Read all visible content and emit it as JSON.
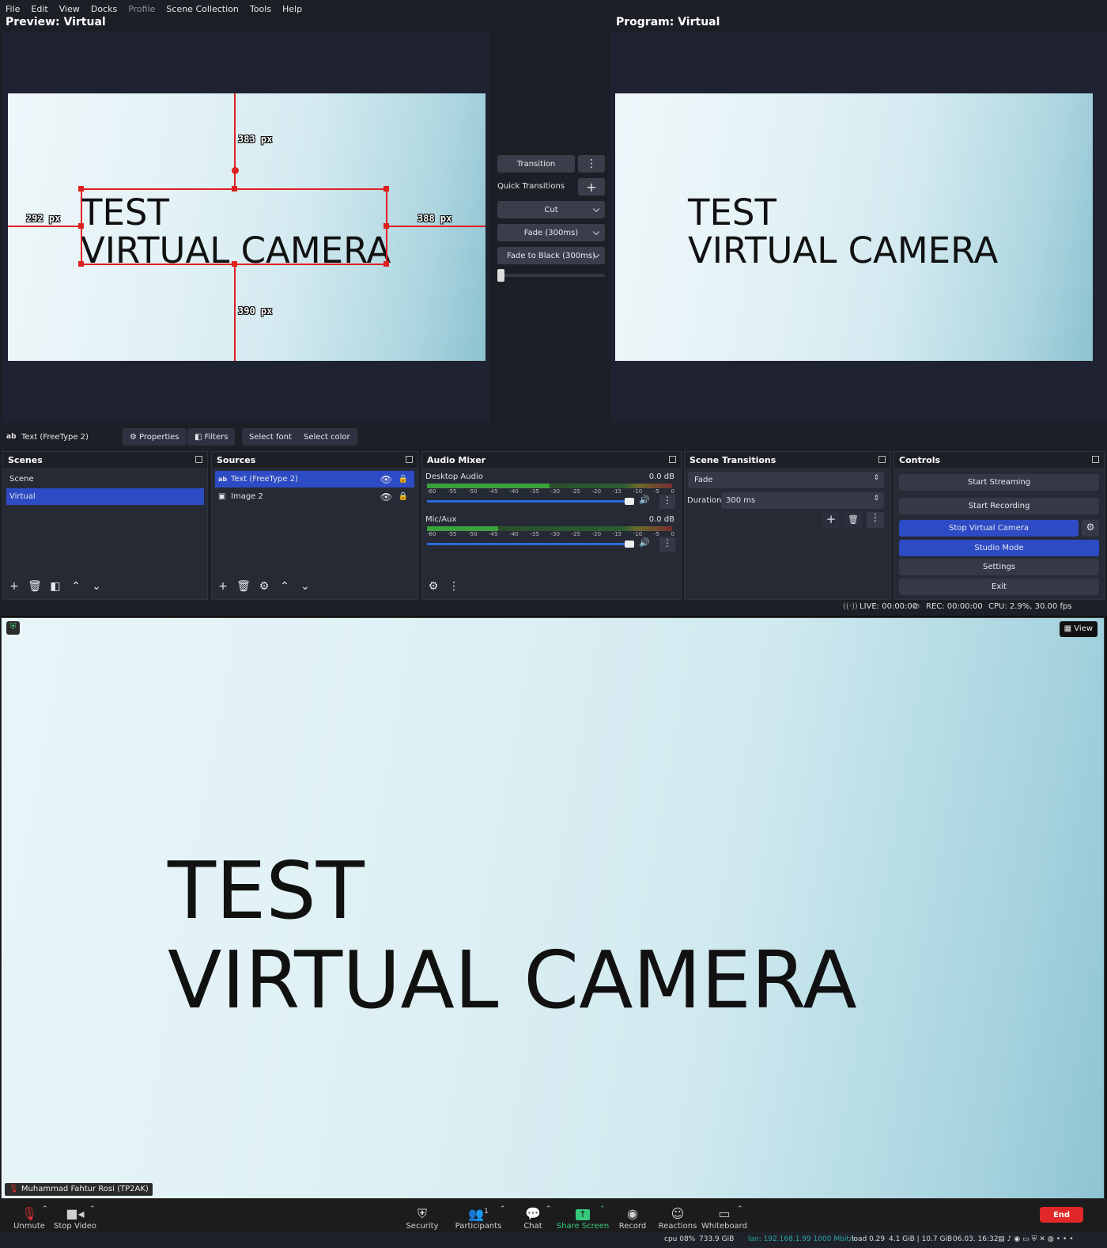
{
  "menu": [
    {
      "label": "File",
      "dim": false
    },
    {
      "label": "Edit",
      "dim": false
    },
    {
      "label": "View",
      "dim": false
    },
    {
      "label": "Docks",
      "dim": false
    },
    {
      "label": "Profile",
      "dim": true
    },
    {
      "label": "Scene Collection",
      "dim": false
    },
    {
      "label": "Tools",
      "dim": false
    },
    {
      "label": "Help",
      "dim": false
    }
  ],
  "preview": {
    "title": "Preview: Virtual",
    "line1": "TEST",
    "line2": "VIRTUAL CAMERA",
    "dist_top": "383 px",
    "dist_left": "292 px",
    "dist_right": "388 px",
    "dist_bottom": "390 px"
  },
  "program": {
    "title": "Program: Virtual",
    "line1": "TEST",
    "line2": "VIRTUAL CAMERA"
  },
  "transitions_panel": {
    "transition": "Transition",
    "quick_transitions": "Quick Transitions",
    "items": [
      "Cut",
      "Fade (300ms)",
      "Fade to Black (300ms)"
    ]
  },
  "context_bar": {
    "source": "Text (FreeType 2)",
    "properties": "Properties",
    "filters": "Filters",
    "select_font": "Select font",
    "select_color": "Select color"
  },
  "scenes": {
    "title": "Scenes",
    "items": [
      "Scene",
      "Virtual"
    ],
    "selected": 1
  },
  "sources": {
    "title": "Sources",
    "items": [
      "Text (FreeType 2)",
      "Image 2"
    ],
    "selected": 0
  },
  "audio_mixer": {
    "title": "Audio Mixer",
    "channels": [
      {
        "name": "Desktop Audio",
        "db": "0.0 dB",
        "level": 0.5
      },
      {
        "name": "Mic/Aux",
        "db": "0.0 dB",
        "level": 0.29
      }
    ],
    "scale": [
      "-60",
      "-55",
      "-50",
      "-45",
      "-40",
      "-35",
      "-30",
      "-25",
      "-20",
      "-15",
      "-10",
      "-5",
      "0"
    ]
  },
  "scene_transitions": {
    "title": "Scene Transitions",
    "current": "Fade",
    "duration_label": "Duration",
    "duration": "300 ms"
  },
  "controls": {
    "title": "Controls",
    "start_streaming": "Start Streaming",
    "start_recording": "Start Recording",
    "stop_virtual_camera": "Stop Virtual Camera",
    "studio_mode": "Studio Mode",
    "settings": "Settings",
    "exit": "Exit"
  },
  "status": {
    "live": "LIVE: 00:00:00",
    "rec": "REC: 00:00:00",
    "cpu": "CPU: 2.9%, 30.00 fps"
  },
  "zoom": {
    "line1": "TEST",
    "line2": "VIRTUAL CAMERA",
    "view": "View",
    "participant": "Muhammad Fahtur Rosi (TP2AK)",
    "toolbar": [
      "Unmute",
      "Stop Video",
      "Security",
      "Participants",
      "Chat",
      "Share Screen",
      "Record",
      "Reactions",
      "Whiteboard"
    ],
    "participants_count": "1",
    "end": "End"
  },
  "sysbar": {
    "cpu": "cpu 08%",
    "disk": "733.9 GiB",
    "lan": "lan: 192.168.1.99 1000 Mbit/s",
    "load": "load 0.29",
    "mem": "4.1 GiB | 10.7 GiB",
    "datetime": "06.03. 16:32"
  },
  "colors": {
    "accent": "#2d4bc4",
    "selection": "#e02020",
    "end": "#e02828",
    "share": "#35c77a"
  }
}
